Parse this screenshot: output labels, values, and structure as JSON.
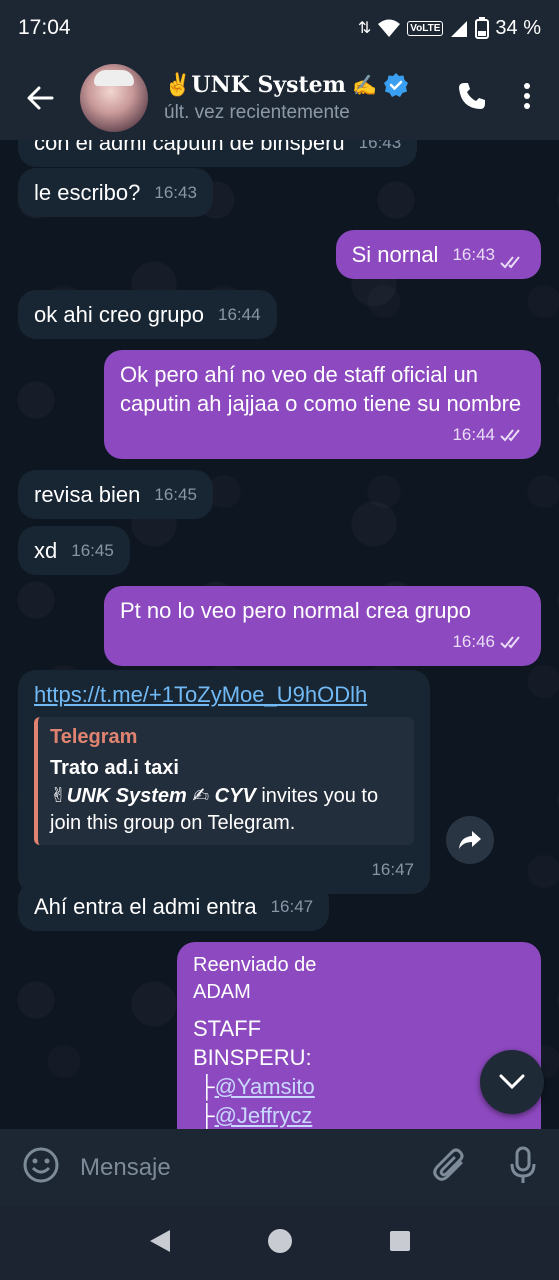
{
  "status": {
    "time": "17:04",
    "volte": "VoLTE",
    "battery": "34 %"
  },
  "header": {
    "title": "✌UNK System",
    "title_suffix": "✍",
    "subtitle": "últ. vez recientemente"
  },
  "messages": {
    "m0": {
      "text": "con el admi caputin de binsperu",
      "time": "16:43"
    },
    "m1": {
      "text": "le escribo?",
      "time": "16:43"
    },
    "m2": {
      "text": "Si nornal",
      "time": "16:43"
    },
    "m3": {
      "text": "ok ahi creo grupo",
      "time": "16:44"
    },
    "m4": {
      "text": "Ok pero ahí no veo de staff oficial un caputin ah jajjaa o como tiene su nombre",
      "time": "16:44"
    },
    "m5": {
      "text": "revisa bien",
      "time": "16:45"
    },
    "m6": {
      "text": "xd",
      "time": "16:45"
    },
    "m7": {
      "text": "Pt no lo veo pero normal crea grupo",
      "time": "16:46"
    },
    "m8": {
      "link": "https://t.me/+1ToZyMoe_U9hODlh",
      "site": "Telegram",
      "preview_title": "Trato ad.i taxi",
      "preview_desc_name": "✌UNK System ✍ CYV",
      "preview_desc_rest": " invites you to join this group on Telegram.",
      "time": "16:47"
    },
    "m9": {
      "text": "Ahí entra el admi entra",
      "time": "16:47"
    },
    "m10": {
      "forwarded_label": "Reenviado de",
      "forwarded_from": "ADAM",
      "line1": "STAFF",
      "line2": "BINSPERU:",
      "user1": "@Yamsito",
      "user2": "@Jeffrycz",
      "tree": "├"
    }
  },
  "input": {
    "placeholder": "Mensaje"
  },
  "colors": {
    "outgoing": "#8d49bf",
    "incoming": "#182533",
    "link": "#71baf5",
    "header": "#1d2733"
  },
  "icons": [
    "back-arrow-icon",
    "verified-icon",
    "phone-icon",
    "more-vert-icon",
    "emoji-icon",
    "attach-icon",
    "mic-icon",
    "share-icon",
    "chevron-down-icon",
    "nav-back-icon",
    "nav-home-icon",
    "nav-recents-icon"
  ]
}
